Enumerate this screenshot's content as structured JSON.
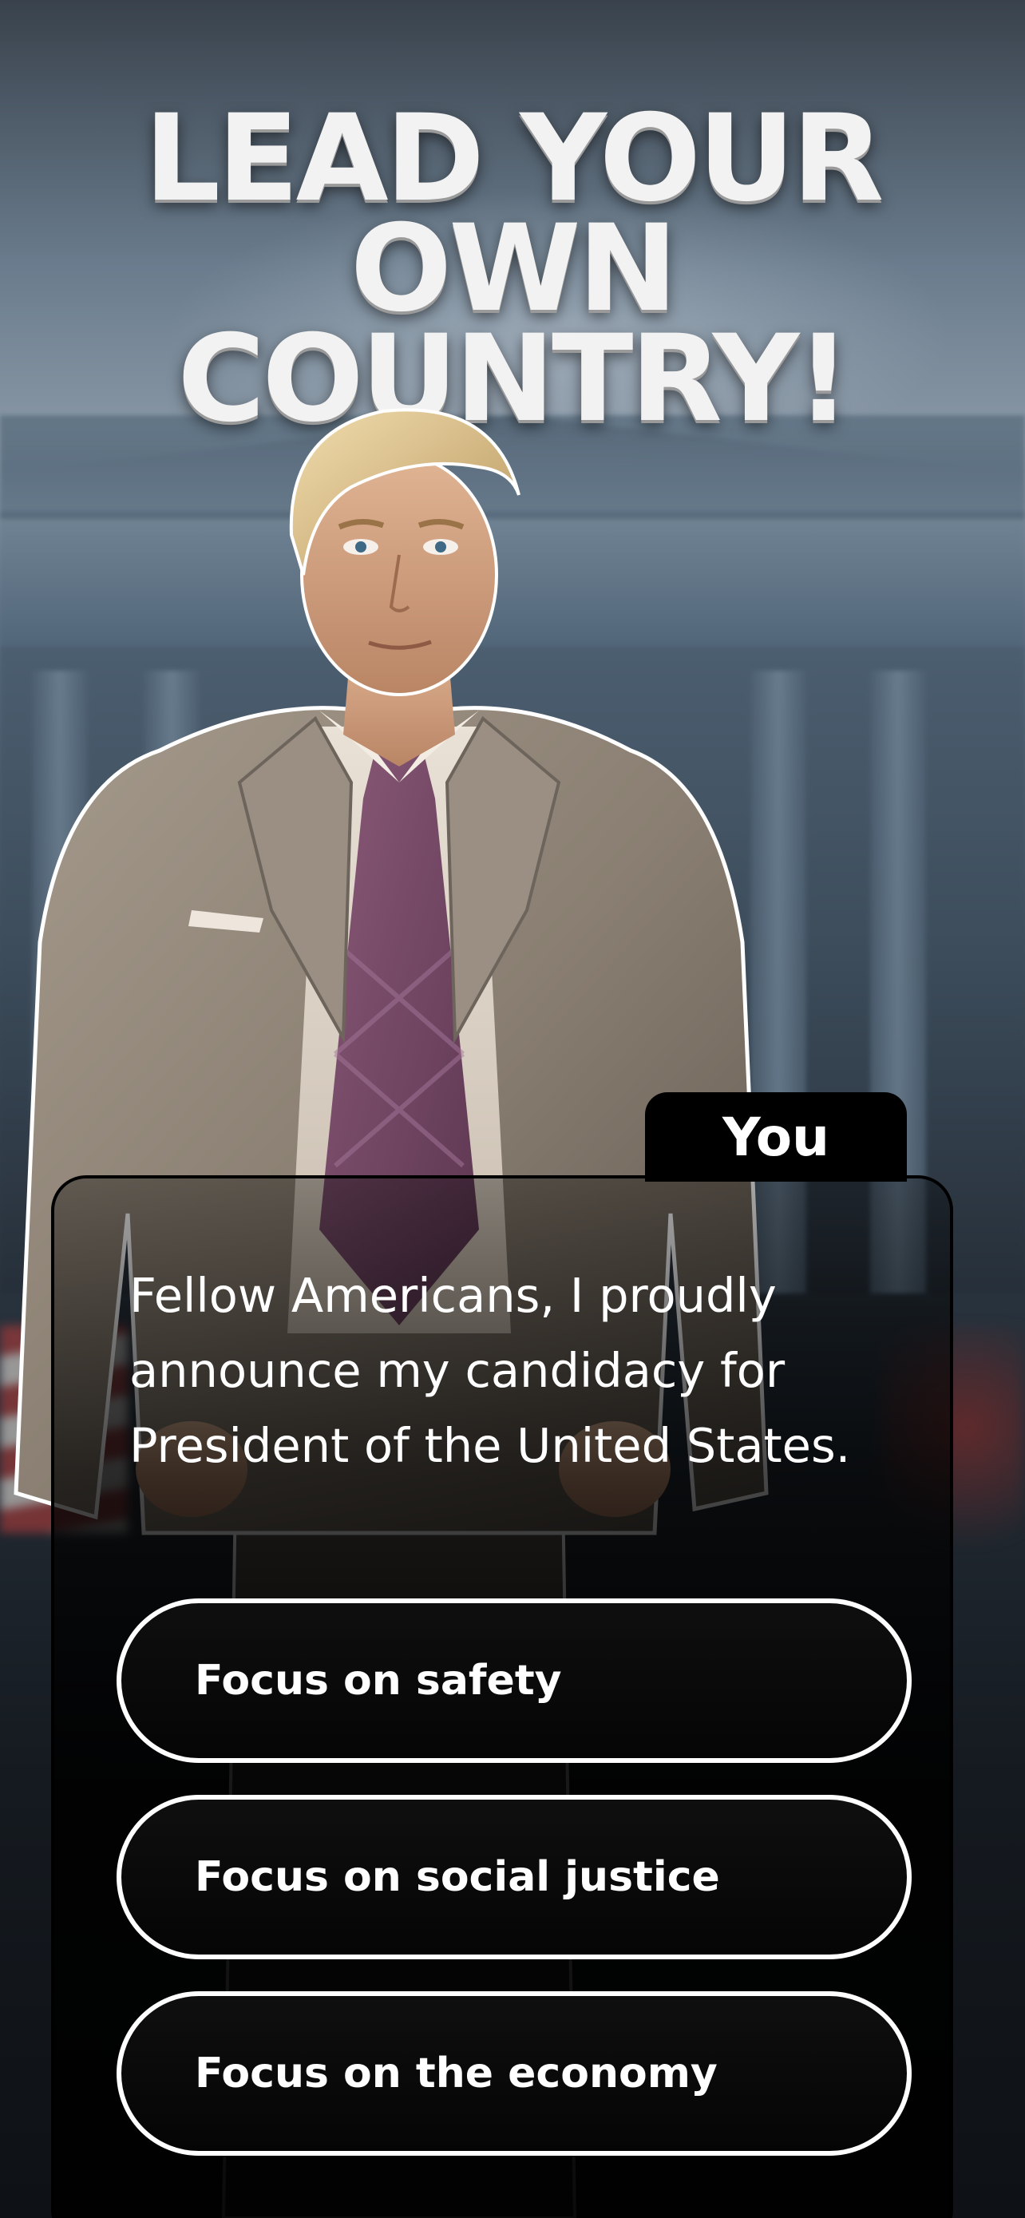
{
  "headline": {
    "line1": "LEAD YOUR",
    "line2": "OWN COUNTRY!"
  },
  "dialog": {
    "speaker": "You",
    "text": "Fellow Americans, I proudly announce my candidacy for President of the United States.",
    "choices": [
      {
        "label": "Focus on safety"
      },
      {
        "label": "Focus on social justice"
      },
      {
        "label": "Focus on the economy"
      }
    ]
  },
  "colors": {
    "panel": "#000000",
    "choice_border": "#ffffff",
    "text": "#ffffff"
  }
}
